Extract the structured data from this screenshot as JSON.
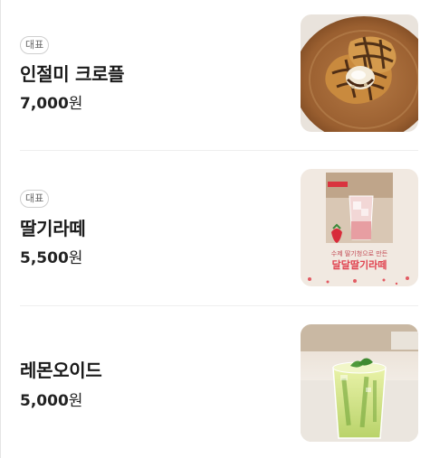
{
  "menu": {
    "items": [
      {
        "badge": "대표",
        "name": "인절미 크로플",
        "price": "7,000",
        "currency": "원",
        "image": "croffle-photo"
      },
      {
        "badge": "대표",
        "name": "딸기라떼",
        "price": "5,500",
        "currency": "원",
        "image": "strawberry-latte-poster",
        "poster": {
          "caption": "수제 딸기청으로 만든",
          "headline": "달달딸기라떼"
        }
      },
      {
        "name": "레몬오이드",
        "price": "5,000",
        "currency": "원",
        "image": "lemonade-photo"
      }
    ]
  }
}
